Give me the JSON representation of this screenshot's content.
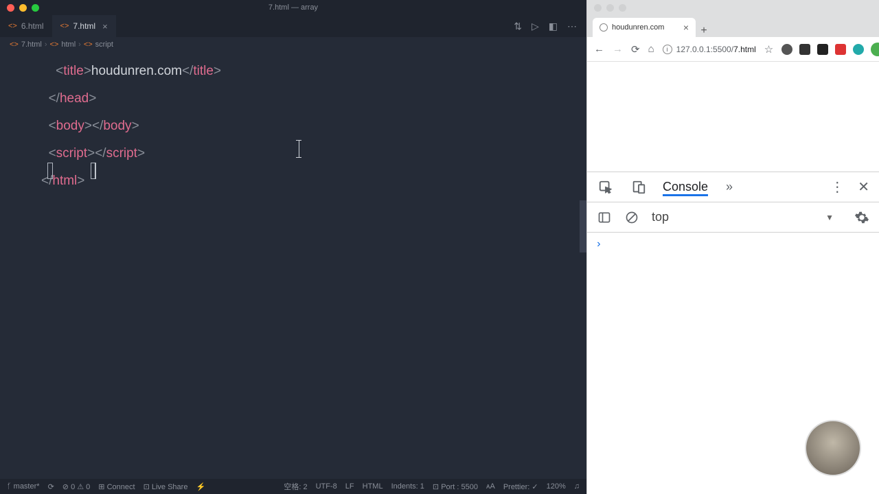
{
  "vscode": {
    "title": "7.html — array",
    "tabs": [
      {
        "label": "6.html",
        "active": false
      },
      {
        "label": "7.html",
        "active": true
      }
    ],
    "breadcrumb": {
      "p1": "7.html",
      "p2": "html",
      "p3": "script"
    },
    "code": {
      "l1_text": "houdunren.com",
      "l1_open": "title",
      "l1_close": "title",
      "l2": "head",
      "l3": "body",
      "l4": "script",
      "l5": "html"
    },
    "status": {
      "branch": "master*",
      "errors": "0",
      "warnings": "0",
      "connect": "Connect",
      "liveshare": "Live Share",
      "spaces": "空格: 2",
      "encoding": "UTF-8",
      "eol": "LF",
      "lang": "HTML",
      "indents": "Indents: 1",
      "port": "Port : 5500",
      "prettier": "Prettier: ✓",
      "zoom": "120%"
    }
  },
  "browser": {
    "tab_title": "houdunren.com",
    "url_prefix": "127.0.0.1:5500/",
    "url_path": "7.html",
    "devtools": {
      "tab_console": "Console",
      "context": "top"
    }
  }
}
